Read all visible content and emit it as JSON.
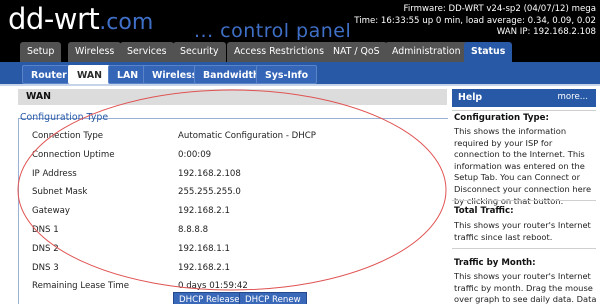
{
  "header": {
    "logo_main": "dd-wrt",
    "logo_suffix": ".com",
    "logo_tag": "... control panel",
    "firmware": "Firmware: DD-WRT v24-sp2 (04/07/12) mega",
    "time": "Time: 16:33:55 up 0 min, load average: 0.34, 0.09, 0.02",
    "wan_ip": "WAN IP: 192.168.2.108"
  },
  "main_tabs": [
    "Setup",
    "Wireless",
    "Services",
    "Security",
    "Access Restrictions",
    "NAT / QoS",
    "Administration",
    "Status"
  ],
  "main_tab_active": "Status",
  "sub_tabs": [
    "Router",
    "WAN",
    "LAN",
    "Wireless",
    "Bandwidth",
    "Sys-Info"
  ],
  "sub_tab_active": "WAN",
  "content": {
    "section_title": "WAN",
    "legend": "Configuration Type",
    "rows": [
      {
        "label": "Connection Type",
        "value": "Automatic Configuration - DHCP"
      },
      {
        "label": "Connection Uptime",
        "value": "0:00:09"
      },
      {
        "label": "IP Address",
        "value": "192.168.2.108"
      },
      {
        "label": "Subnet Mask",
        "value": "255.255.255.0"
      },
      {
        "label": "Gateway",
        "value": "192.168.2.1"
      },
      {
        "label": "DNS 1",
        "value": "8.8.8.8"
      },
      {
        "label": "DNS 2",
        "value": "192.168.1.1"
      },
      {
        "label": "DNS 3",
        "value": "192.168.2.1"
      },
      {
        "label": "Remaining Lease Time",
        "value": "0 days 01:59:42"
      }
    ],
    "buttons": {
      "release": "DHCP Release",
      "renew": "DHCP Renew"
    }
  },
  "help": {
    "title": "Help",
    "more": "more...",
    "sections": [
      {
        "title": "Configuration Type:",
        "text": "This shows the information required by your ISP for connection to the Internet. This information was entered on the Setup Tab. You can Connect or Disconnect your connection here by clicking on that button."
      },
      {
        "title": "Total Traffic:",
        "text": "This shows your router's Internet traffic since last reboot."
      },
      {
        "title": "Traffic by Month:",
        "text": "This shows your router's Internet traffic by month. Drag the mouse over graph to see daily data. Data is stored"
      }
    ]
  },
  "annotation": {
    "color": "#e05353"
  }
}
